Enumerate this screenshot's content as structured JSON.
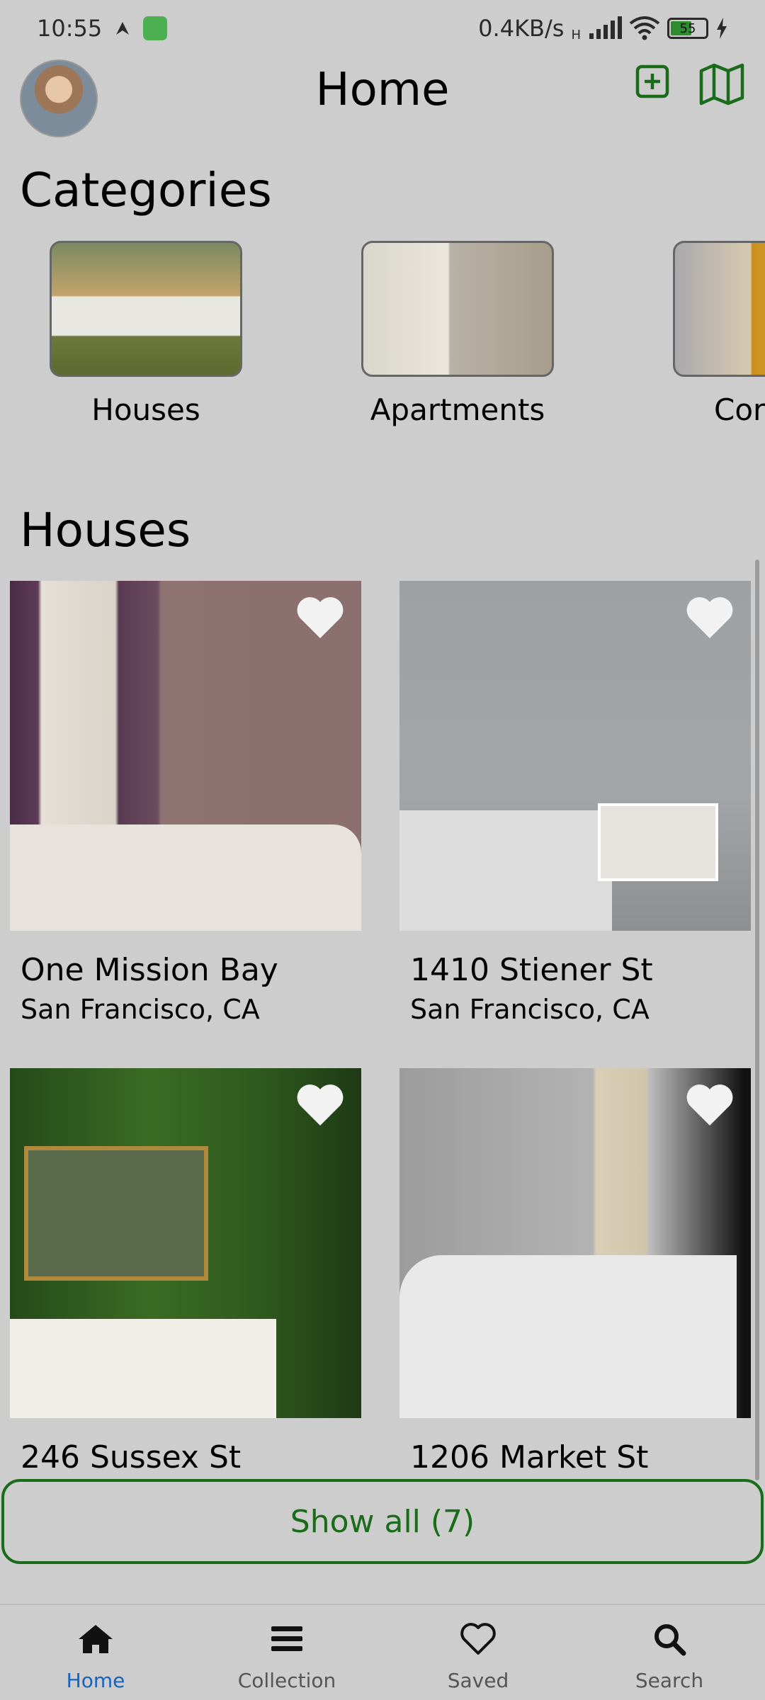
{
  "status_bar": {
    "time": "10:55",
    "network_speed": "0.4KB/s",
    "network_type": "H",
    "battery_level": "55",
    "icons": [
      "notification-icon",
      "app-icon",
      "signal-icon",
      "wifi-icon",
      "battery-icon",
      "charging-icon"
    ]
  },
  "header": {
    "title": "Home",
    "icons": [
      "avatar",
      "add-square-icon",
      "map-icon"
    ]
  },
  "categories": {
    "title": "Categories",
    "items": [
      {
        "label": "Houses"
      },
      {
        "label": "Apartments"
      },
      {
        "label": "Cor"
      }
    ]
  },
  "houses": {
    "title": "Houses",
    "listings": [
      {
        "name": "One Mission Bay",
        "city": "San Francisco, CA"
      },
      {
        "name": "1410 Stiener St",
        "city": "San Francisco, CA"
      },
      {
        "name": "246 Sussex St",
        "city": ""
      },
      {
        "name": "1206 Market St",
        "city": ""
      }
    ],
    "show_all_label": "Show all (7)"
  },
  "bottom_nav": {
    "items": [
      {
        "label": "Home",
        "icon": "home-icon",
        "active": true
      },
      {
        "label": "Collection",
        "icon": "menu-icon",
        "active": false
      },
      {
        "label": "Saved",
        "icon": "heart-icon",
        "active": false
      },
      {
        "label": "Search",
        "icon": "search-icon",
        "active": false
      }
    ]
  },
  "colors": {
    "accent": "#1a6b1a",
    "active_nav": "#1565c0",
    "background": "#cdcdcd"
  }
}
